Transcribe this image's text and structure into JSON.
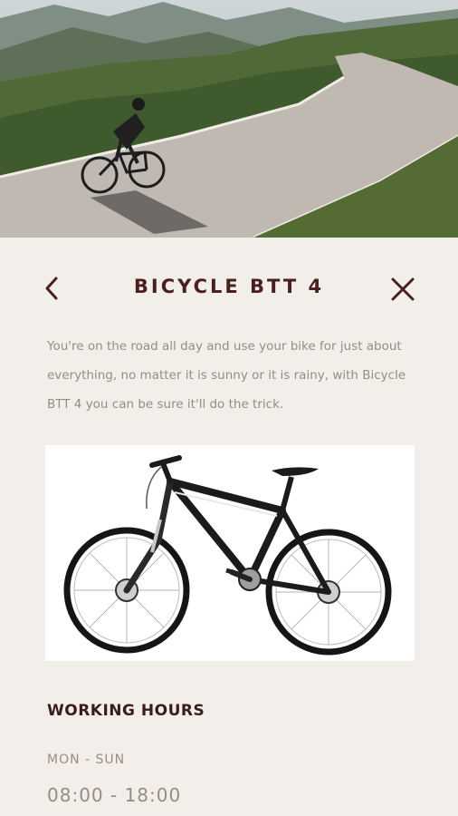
{
  "header": {
    "title": "BICYCLE BTT 4",
    "back_icon": "chevron-left-icon",
    "close_icon": "close-icon"
  },
  "description": "You're on the road all day and use your bike for just about everything, no matter it is sunny or it is rainy, with Bicycle BTT 4 you can be sure it'll do the trick.",
  "working_hours": {
    "title": "WORKING HOURS",
    "days": "MON - SUN",
    "time": "08:00 - 18:00"
  },
  "colors": {
    "background": "#f2efea",
    "title": "#4a1f1c",
    "body_text": "#9a8b80"
  }
}
